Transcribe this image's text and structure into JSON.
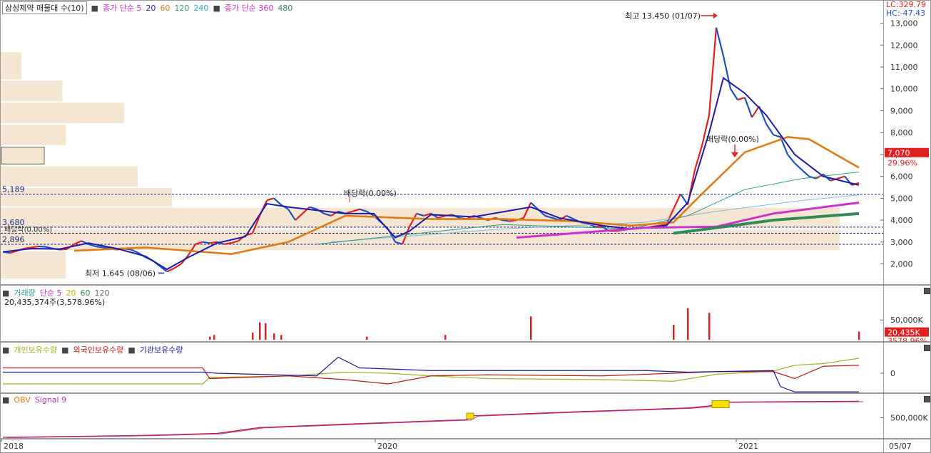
{
  "window": {
    "title": "삼성제약 매물대 수(10)"
  },
  "main_header": {
    "ma_label": "종가 단순 5",
    "ma_periods": [
      "20",
      "60",
      "120",
      "240"
    ],
    "ma2_label": "종가 단순 360",
    "ma2_periods": [
      "480"
    ],
    "lc_label": "LC:329.79",
    "hc_label": "HC:-47.43"
  },
  "annotations": {
    "high_label": "최고 13,450 (01/07)",
    "low_label": "최저 1,645 (08/06)",
    "dividend_1": "배당락(0.00%)",
    "dividend_2": "배당락(0.00%)",
    "dividend_3": "배당락(0.00%)",
    "level_5189": "5,189",
    "level_3680": "3,680",
    "level_2896": "2,896",
    "last_price": "7,070",
    "last_pct": "29.96%"
  },
  "volume_panel": {
    "title": "거래량",
    "ma_label": "단순 5",
    "ma_periods": [
      "20",
      "60",
      "120"
    ],
    "value_text": "20,435,374주(3,578.96%)",
    "last_badge": "20,435K",
    "last_pct": "3578.96%"
  },
  "holdings_panel": {
    "series": [
      "개인보유수량",
      "외국인보유수량",
      "기관보유수량"
    ]
  },
  "obv_panel": {
    "series": [
      "OBV",
      "Signal 9"
    ]
  },
  "date_axis": {
    "labels": [
      "2018",
      "2020",
      "2021"
    ],
    "current_date": "05/07"
  },
  "colors": {
    "ma5": "#1c1ca8",
    "ma20": "#e07a14",
    "ma60": "#2a9c8c",
    "ma120": "#b0c4e0",
    "ma360": "#cc33cc",
    "ma480": "#2e8b57",
    "up": "#e02020",
    "down": "#2050c0",
    "profile": "#f5e6d3",
    "individual": "#a8ae28",
    "foreign": "#c01818",
    "institution": "#1a1a9a"
  },
  "chart_data": [
    {
      "type": "line",
      "title": "삼성제약 매물대 수(10)",
      "y_ticks": [
        2000,
        3000,
        4000,
        5000,
        6000,
        7000,
        8000,
        9000,
        10000,
        11000,
        12000,
        13000
      ],
      "y_tick_labels": [
        "2,000",
        "3,000",
        "4,000",
        "5,000",
        "6,000",
        "7,000",
        "8,000",
        "9,000",
        "10,000",
        "11,000",
        "12,000",
        "13,000"
      ],
      "ylim": [
        1300,
        13800
      ],
      "x_labels": [
        "2018",
        "2020",
        "2021"
      ],
      "price_points": [
        [
          0,
          2550
        ],
        [
          5,
          2500
        ],
        [
          10,
          2600
        ],
        [
          15,
          2700
        ],
        [
          20,
          2750
        ],
        [
          25,
          2800
        ],
        [
          30,
          2780
        ],
        [
          35,
          2700
        ],
        [
          40,
          2650
        ],
        [
          45,
          2680
        ],
        [
          50,
          2900
        ],
        [
          55,
          3050
        ],
        [
          60,
          2900
        ],
        [
          65,
          2800
        ],
        [
          70,
          2750
        ],
        [
          75,
          2700
        ],
        [
          80,
          2650
        ],
        [
          85,
          2700
        ],
        [
          90,
          2650
        ],
        [
          95,
          2500
        ],
        [
          100,
          2300
        ],
        [
          105,
          2150
        ],
        [
          110,
          1900
        ],
        [
          115,
          1645
        ],
        [
          120,
          1800
        ],
        [
          125,
          2000
        ],
        [
          130,
          2400
        ],
        [
          135,
          2900
        ],
        [
          140,
          3000
        ],
        [
          145,
          2950
        ],
        [
          150,
          3000
        ],
        [
          155,
          2900
        ],
        [
          160,
          2950
        ],
        [
          165,
          3050
        ],
        [
          170,
          3300
        ],
        [
          175,
          3400
        ],
        [
          180,
          4200
        ],
        [
          185,
          4900
        ],
        [
          190,
          5000
        ],
        [
          195,
          4700
        ],
        [
          200,
          4500
        ],
        [
          205,
          4000
        ],
        [
          210,
          4300
        ],
        [
          215,
          4600
        ],
        [
          220,
          4500
        ],
        [
          225,
          4300
        ],
        [
          230,
          4200
        ],
        [
          235,
          4400
        ],
        [
          240,
          4300
        ],
        [
          245,
          4400
        ],
        [
          250,
          4500
        ],
        [
          255,
          4400
        ],
        [
          260,
          4200
        ],
        [
          265,
          3900
        ],
        [
          270,
          3600
        ],
        [
          275,
          3000
        ],
        [
          280,
          2900
        ],
        [
          285,
          3700
        ],
        [
          290,
          4300
        ],
        [
          295,
          4200
        ],
        [
          300,
          4300
        ],
        [
          305,
          4100
        ],
        [
          310,
          4200
        ],
        [
          315,
          4250
        ],
        [
          320,
          4100
        ],
        [
          325,
          4050
        ],
        [
          330,
          4200
        ],
        [
          335,
          4100
        ],
        [
          340,
          4000
        ],
        [
          345,
          4100
        ],
        [
          350,
          4000
        ],
        [
          355,
          3950
        ],
        [
          360,
          4000
        ],
        [
          365,
          4100
        ],
        [
          370,
          4800
        ],
        [
          375,
          4500
        ],
        [
          380,
          4200
        ],
        [
          385,
          4100
        ],
        [
          390,
          4000
        ],
        [
          395,
          4200
        ],
        [
          400,
          4050
        ],
        [
          405,
          3900
        ],
        [
          410,
          3850
        ],
        [
          415,
          3700
        ],
        [
          420,
          3700
        ],
        [
          425,
          3500
        ],
        [
          430,
          3500
        ],
        [
          435,
          3550
        ],
        [
          440,
          3600
        ],
        [
          445,
          3650
        ],
        [
          450,
          3650
        ],
        [
          455,
          3700
        ],
        [
          460,
          3750
        ],
        [
          465,
          3800
        ],
        [
          470,
          4500
        ],
        [
          475,
          5200
        ],
        [
          480,
          4700
        ],
        [
          485,
          6300
        ],
        [
          490,
          7400
        ],
        [
          495,
          8800
        ],
        [
          500,
          12800
        ],
        [
          505,
          11500
        ],
        [
          510,
          10000
        ],
        [
          515,
          9500
        ],
        [
          520,
          9600
        ],
        [
          525,
          8700
        ],
        [
          530,
          9200
        ],
        [
          535,
          8400
        ],
        [
          540,
          7900
        ],
        [
          545,
          7800
        ],
        [
          550,
          7000
        ],
        [
          555,
          6600
        ],
        [
          560,
          6300
        ],
        [
          565,
          6000
        ],
        [
          570,
          5900
        ],
        [
          575,
          6100
        ],
        [
          580,
          5800
        ],
        [
          585,
          5900
        ],
        [
          590,
          6000
        ],
        [
          595,
          5600
        ],
        [
          600,
          5700
        ]
      ],
      "ma5_points": [
        [
          0,
          2550
        ],
        [
          20,
          2700
        ],
        [
          40,
          2680
        ],
        [
          60,
          2950
        ],
        [
          80,
          2700
        ],
        [
          100,
          2350
        ],
        [
          115,
          1750
        ],
        [
          130,
          2300
        ],
        [
          150,
          2950
        ],
        [
          170,
          3250
        ],
        [
          185,
          4750
        ],
        [
          200,
          4600
        ],
        [
          220,
          4450
        ],
        [
          240,
          4300
        ],
        [
          260,
          4300
        ],
        [
          275,
          3200
        ],
        [
          285,
          3500
        ],
        [
          300,
          4250
        ],
        [
          330,
          4150
        ],
        [
          370,
          4600
        ],
        [
          390,
          4100
        ],
        [
          420,
          3750
        ],
        [
          440,
          3600
        ],
        [
          465,
          3750
        ],
        [
          480,
          4800
        ],
        [
          495,
          8000
        ],
        [
          505,
          10500
        ],
        [
          520,
          9800
        ],
        [
          535,
          8800
        ],
        [
          555,
          7000
        ],
        [
          575,
          6000
        ],
        [
          600,
          5600
        ]
      ],
      "ma20_points": [
        [
          50,
          2600
        ],
        [
          100,
          2750
        ],
        [
          160,
          2450
        ],
        [
          200,
          3000
        ],
        [
          240,
          4200
        ],
        [
          300,
          4050
        ],
        [
          350,
          4050
        ],
        [
          400,
          3950
        ],
        [
          440,
          3750
        ],
        [
          470,
          3900
        ],
        [
          490,
          5200
        ],
        [
          520,
          7100
        ],
        [
          550,
          7800
        ],
        [
          565,
          7700
        ],
        [
          600,
          6400
        ]
      ],
      "ma60_points": [
        [
          220,
          2900
        ],
        [
          350,
          3800
        ],
        [
          440,
          3600
        ],
        [
          480,
          4200
        ],
        [
          520,
          5400
        ],
        [
          560,
          5900
        ],
        [
          600,
          6200
        ]
      ],
      "ma120_points": [
        [
          230,
          3000
        ],
        [
          350,
          3600
        ],
        [
          450,
          3900
        ],
        [
          500,
          4400
        ],
        [
          560,
          4900
        ],
        [
          600,
          5150
        ]
      ],
      "ma360_points": [
        [
          360,
          3200
        ],
        [
          450,
          3650
        ],
        [
          500,
          3700
        ],
        [
          540,
          4300
        ],
        [
          600,
          4800
        ]
      ],
      "ma480_points": [
        [
          470,
          3400
        ],
        [
          500,
          3650
        ],
        [
          540,
          4000
        ],
        [
          600,
          4300
        ]
      ],
      "volume_profile": [
        {
          "price_from": 10400,
          "price_to": 11700,
          "length": 0.12
        },
        {
          "price_from": 9400,
          "price_to": 10400,
          "length": 0.36
        },
        {
          "price_from": 8400,
          "price_to": 9400,
          "length": 0.72
        },
        {
          "price_from": 7400,
          "price_to": 8400,
          "length": 0.38
        },
        {
          "price_from": 6500,
          "price_to": 7400,
          "length": 0.25
        },
        {
          "price_from": 5500,
          "price_to": 6500,
          "length": 0.8
        },
        {
          "price_from": 4600,
          "price_to": 5500,
          "length": 1.0
        },
        {
          "price_from": 3600,
          "price_to": 4600,
          "length": 4.9
        },
        {
          "price_from": 2600,
          "price_to": 3600,
          "length": 4.9
        },
        {
          "price_from": 1300,
          "price_to": 2600,
          "length": 0.38
        }
      ],
      "levels": [
        5189,
        3680,
        3400,
        2896
      ]
    },
    {
      "type": "bar",
      "title": "거래량",
      "y_tick_labels": [
        "50,000K"
      ],
      "volume_spikes": [
        [
          145,
          8000
        ],
        [
          148,
          12000
        ],
        [
          175,
          18000
        ],
        [
          180,
          44000
        ],
        [
          184,
          42000
        ],
        [
          190,
          16000
        ],
        [
          195,
          12000
        ],
        [
          255,
          8000
        ],
        [
          310,
          12000
        ],
        [
          370,
          59000
        ],
        [
          470,
          38000
        ],
        [
          480,
          80000
        ],
        [
          495,
          68000
        ],
        [
          600,
          20435
        ]
      ]
    },
    {
      "type": "line",
      "title": "개인보유수량 외국인보유수량 기관보유수량",
      "y_tick_labels": [
        "0"
      ],
      "individual_points": [
        [
          0,
          -20
        ],
        [
          140,
          -20
        ],
        [
          145,
          -8
        ],
        [
          200,
          -5
        ],
        [
          240,
          2
        ],
        [
          270,
          0
        ],
        [
          300,
          -5
        ],
        [
          340,
          -10
        ],
        [
          420,
          -12
        ],
        [
          470,
          -15
        ],
        [
          500,
          -2
        ],
        [
          540,
          4
        ],
        [
          555,
          15
        ],
        [
          575,
          18
        ],
        [
          600,
          28
        ]
      ],
      "foreign_points": [
        [
          0,
          10
        ],
        [
          140,
          10
        ],
        [
          145,
          -10
        ],
        [
          200,
          -5
        ],
        [
          240,
          -12
        ],
        [
          270,
          -20
        ],
        [
          300,
          -5
        ],
        [
          340,
          -3
        ],
        [
          420,
          -5
        ],
        [
          470,
          0
        ],
        [
          500,
          3
        ],
        [
          540,
          3
        ],
        [
          555,
          -10
        ],
        [
          575,
          13
        ],
        [
          600,
          15
        ]
      ],
      "institution_points": [
        [
          0,
          2
        ],
        [
          140,
          2
        ],
        [
          150,
          0
        ],
        [
          220,
          -5
        ],
        [
          235,
          30
        ],
        [
          250,
          10
        ],
        [
          300,
          5
        ],
        [
          380,
          5
        ],
        [
          450,
          5
        ],
        [
          480,
          2
        ],
        [
          540,
          5
        ],
        [
          545,
          -25
        ],
        [
          555,
          -35
        ],
        [
          600,
          -35
        ]
      ]
    },
    {
      "type": "line",
      "title": "OBV Signal 9",
      "y_tick_labels": [
        "500,000K"
      ],
      "obv_points": [
        [
          0,
          0
        ],
        [
          100,
          5
        ],
        [
          150,
          10
        ],
        [
          180,
          25
        ],
        [
          250,
          35
        ],
        [
          325,
          45
        ],
        [
          330,
          55
        ],
        [
          400,
          65
        ],
        [
          480,
          75
        ],
        [
          495,
          80
        ],
        [
          505,
          90
        ],
        [
          600,
          92
        ]
      ]
    }
  ]
}
